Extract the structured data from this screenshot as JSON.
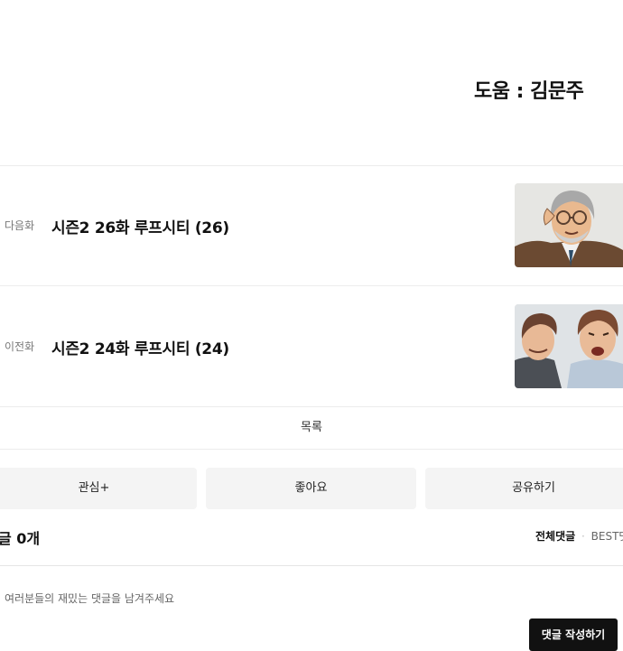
{
  "credit": "도움 : 김문주",
  "episodes": [
    {
      "kind": "다음화",
      "title": "시즌2 26화 루프시티 (26)"
    },
    {
      "kind": "이전화",
      "title": "시즌2 24화 루프시티 (24)"
    }
  ],
  "list_label": "목록",
  "actions": {
    "favorite": "관심+",
    "like": "좋아요",
    "share": "공유하기"
  },
  "comments": {
    "count_label": "글 0개",
    "sort_all": "전체댓글",
    "sort_best": "BEST댓",
    "placeholder": "여러분들의 재밌는 댓글을 남겨주세요",
    "submit_label": "댓글 작성하기"
  }
}
